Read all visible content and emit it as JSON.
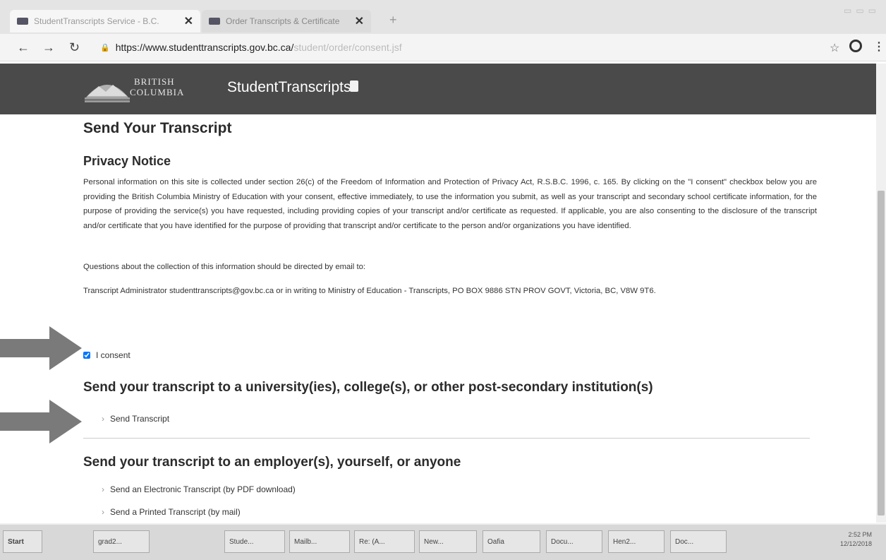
{
  "browser": {
    "active_tab_title": "StudentTranscripts Service - B.C.",
    "inactive_tab_title": "Order Transcripts & Certificate",
    "url_host": "https://www.studenttranscripts.gov.bc.ca/",
    "url_path": "student/order/consent.jsf"
  },
  "header": {
    "logo_line1": "BRITISH",
    "logo_line2": "COLUMBIA",
    "app_title": "StudentTranscripts"
  },
  "page": {
    "title": "Send Your Transcript",
    "privacy_heading": "Privacy Notice",
    "privacy_text": "Personal information on this site is collected under section 26(c) of the Freedom of Information and Protection of Privacy Act, R.S.B.C. 1996, c. 165. By clicking on the \"I consent\" checkbox below you are providing the British Columbia Ministry of Education with your consent, effective immediately, to use the information you submit, as well as your transcript and secondary school certificate information, for the purpose of providing the service(s) you have requested, including providing copies of your transcript and/or certificate as requested. If applicable, you are also consenting to the disclosure of the transcript and/or certificate that you have identified for the purpose of providing that transcript and/or certificate to the person and/or organizations you have identified.",
    "questions_text": "Questions about the collection of this information should be directed by email to:",
    "contact_text": "Transcript Administrator studenttranscripts@gov.bc.ca or in writing to Ministry of Education - Transcripts, PO BOX 9886 STN PROV GOVT, Victoria, BC, V8W 9T6.",
    "consent_label": "I consent",
    "section1_title": "Send your transcript to a university(ies), college(s), or other post-secondary institution(s)",
    "section1_link": "Send Transcript",
    "section2_title": "Send your transcript to an employer(s), yourself, or anyone",
    "section2_link1": "Send an Electronic Transcript (by PDF download)",
    "section2_link2": "Send a Printed Transcript (by mail)"
  },
  "taskbar": {
    "start": "Start",
    "items": [
      "grad2...",
      "Stude...",
      "Mailb...",
      "Re: (A...",
      "New...",
      "Oafia",
      "Docu...",
      "Hen2...",
      "Doc..."
    ],
    "clock_time": "2:52 PM",
    "clock_date": "12/12/2018"
  },
  "colors": {
    "header_bg": "#4a4a4a",
    "arrow": "#7a7a7a"
  }
}
